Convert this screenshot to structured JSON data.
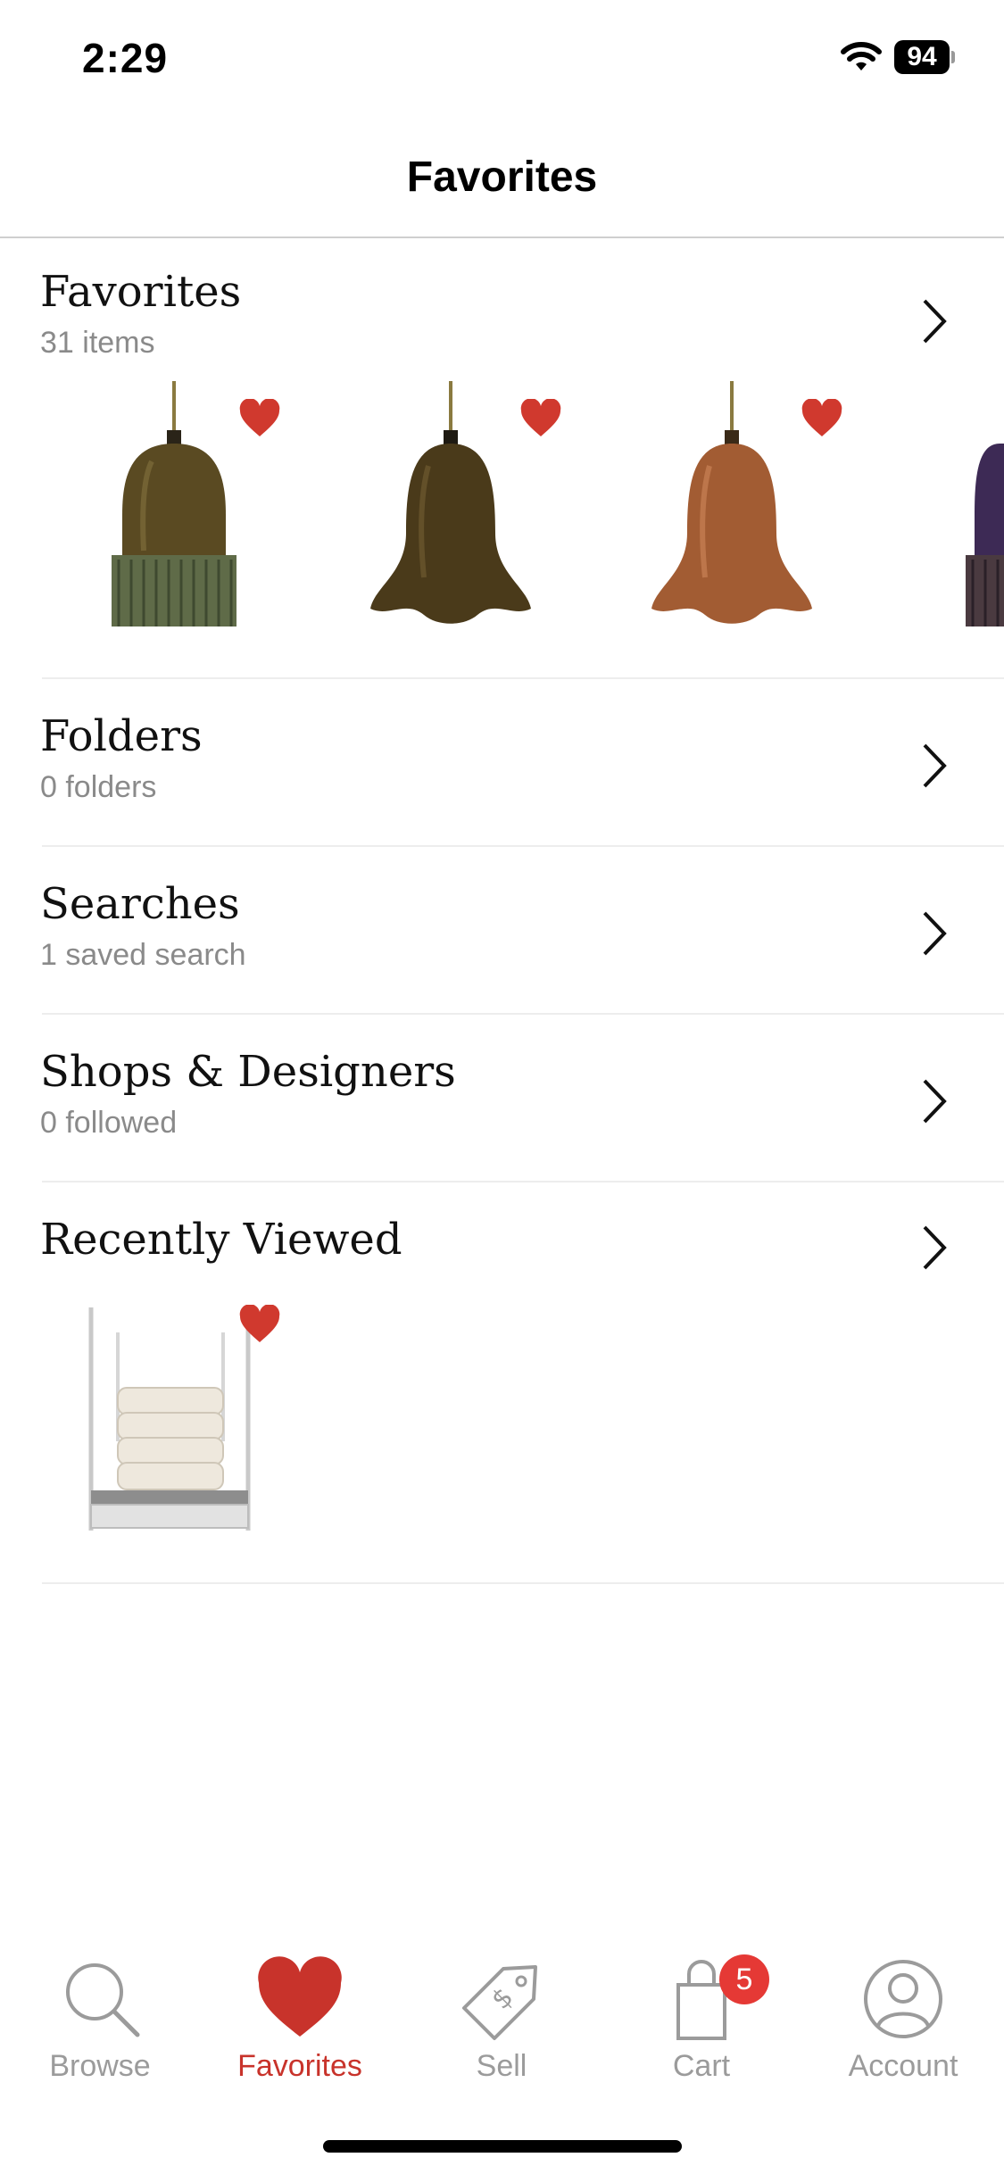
{
  "status_bar": {
    "time": "2:29",
    "battery": "94"
  },
  "header": {
    "title": "Favorites"
  },
  "sections": {
    "favorites": {
      "title": "Favorites",
      "subtitle": "31 items"
    },
    "folders": {
      "title": "Folders",
      "subtitle": "0 folders"
    },
    "searches": {
      "title": "Searches",
      "subtitle": "1 saved search"
    },
    "shops": {
      "title": "Shops & Designers",
      "subtitle": "0 followed"
    },
    "recent": {
      "title": "Recently Viewed"
    }
  },
  "tab_bar": {
    "browse": "Browse",
    "favorites": "Favorites",
    "sell": "Sell",
    "cart": "Cart",
    "cart_badge": "5",
    "account": "Account",
    "active_tab": "Favorites"
  },
  "colors": {
    "accent": "#c8332b",
    "heart": "#d0392e",
    "badge": "#e53935",
    "inactive": "#9b9b9b"
  }
}
